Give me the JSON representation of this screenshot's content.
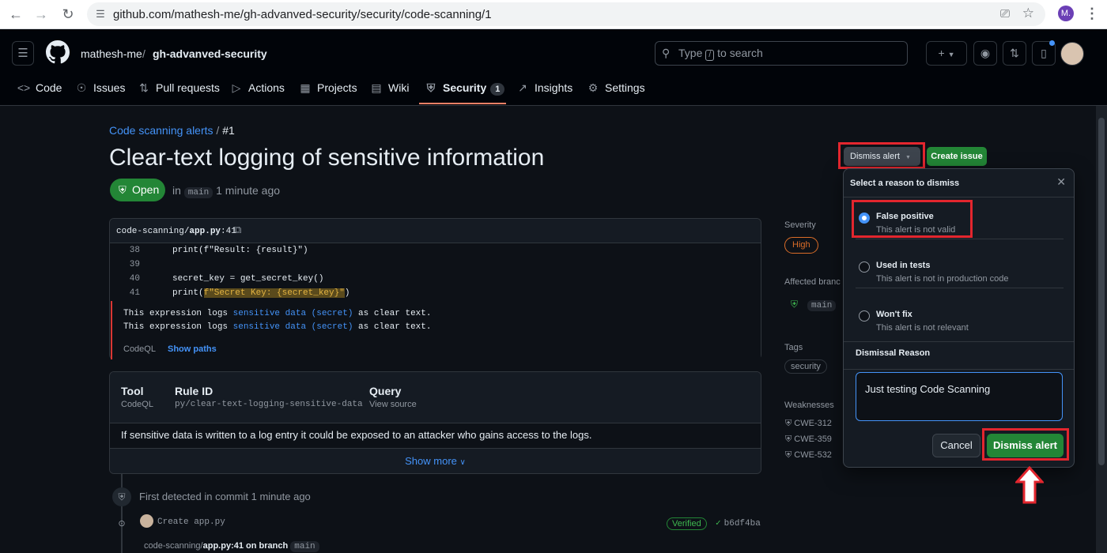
{
  "browser": {
    "url": "github.com/mathesh-me/gh-advanved-security/security/code-scanning/1",
    "profile_initial": "M."
  },
  "header": {
    "owner": "mathesh-me",
    "separator": "/",
    "repo": "gh-advanved-security",
    "search_pre": "Type",
    "search_key": "/",
    "search_post": "to search"
  },
  "tabs": [
    {
      "label": "Code",
      "icon": "code-icon"
    },
    {
      "label": "Issues",
      "icon": "issue-icon"
    },
    {
      "label": "Pull requests",
      "icon": "pull-request-icon"
    },
    {
      "label": "Actions",
      "icon": "play-icon"
    },
    {
      "label": "Projects",
      "icon": "table-icon"
    },
    {
      "label": "Wiki",
      "icon": "book-icon"
    },
    {
      "label": "Security",
      "icon": "shield-icon",
      "count": "1"
    },
    {
      "label": "Insights",
      "icon": "graph-icon"
    },
    {
      "label": "Settings",
      "icon": "gear-icon"
    }
  ],
  "breadcrumb": {
    "link": "Code scanning alerts",
    "sep": "/",
    "current": "#1"
  },
  "alert": {
    "title": "Clear-text logging of sensitive information",
    "status": "Open",
    "in": "in",
    "branch": "main",
    "time": "1 minute ago"
  },
  "code": {
    "file_dir": "code-scanning/",
    "file_name": "app.py",
    "file_line": ":41",
    "lines": [
      {
        "n": "38",
        "code": "print(f\"Result: {result}\")"
      },
      {
        "n": "39",
        "code": ""
      },
      {
        "n": "40",
        "code": "secret_key = get_secret_key()"
      },
      {
        "n": "41",
        "pre": "print(",
        "hl": "f\"Secret Key: {secret_key}\"",
        "post": ")"
      }
    ],
    "messages": [
      {
        "pre": "This expression logs ",
        "link": "sensitive data (secret)",
        "post": " as clear text."
      },
      {
        "pre": "This expression logs ",
        "link": "sensitive data (secret)",
        "post": " as clear text."
      }
    ],
    "tool": "CodeQL",
    "show_paths": "Show paths"
  },
  "info": {
    "tool_h": "Tool",
    "tool_v": "CodeQL",
    "rule_h": "Rule ID",
    "rule_v": "py/clear-text-logging-sensitive-data",
    "query_h": "Query",
    "query_v": "View source",
    "description": "If sensitive data is written to a log entry it could be exposed to an attacker who gains access to the logs.",
    "show_more": "Show more"
  },
  "timeline": {
    "first_detected": "First detected in commit",
    "first_time": "1 minute ago",
    "commit_msg": "Create app.py",
    "verified": "Verified",
    "sha": "b6df4ba",
    "loc_dir": "code-scanning/",
    "loc_file": "app.py:41 on branch",
    "loc_branch": "main"
  },
  "sidebar": {
    "severity_h": "Severity",
    "severity": "High",
    "branches_h": "Affected branc",
    "branch": "main",
    "tags_h": "Tags",
    "tag": "security",
    "weak_h": "Weaknesses",
    "cwes": [
      "CWE-312",
      "CWE-359",
      "CWE-532"
    ]
  },
  "actions": {
    "dismiss": "Dismiss alert",
    "create_issue": "Create issue"
  },
  "popup": {
    "title": "Select a reason to dismiss",
    "options": [
      {
        "label": "False positive",
        "sub": "This alert is not valid",
        "selected": true
      },
      {
        "label": "Used in tests",
        "sub": "This alert is not in production code",
        "selected": false
      },
      {
        "label": "Won't fix",
        "sub": "This alert is not relevant",
        "selected": false
      }
    ],
    "reason_h": "Dismissal Reason",
    "reason_value": "Just testing Code Scanning",
    "cancel": "Cancel",
    "confirm": "Dismiss alert"
  },
  "colors": {
    "accent": "#4493f8",
    "success": "#238636",
    "highlight_box": "#e3262e",
    "severity_high": "#db6d28"
  }
}
